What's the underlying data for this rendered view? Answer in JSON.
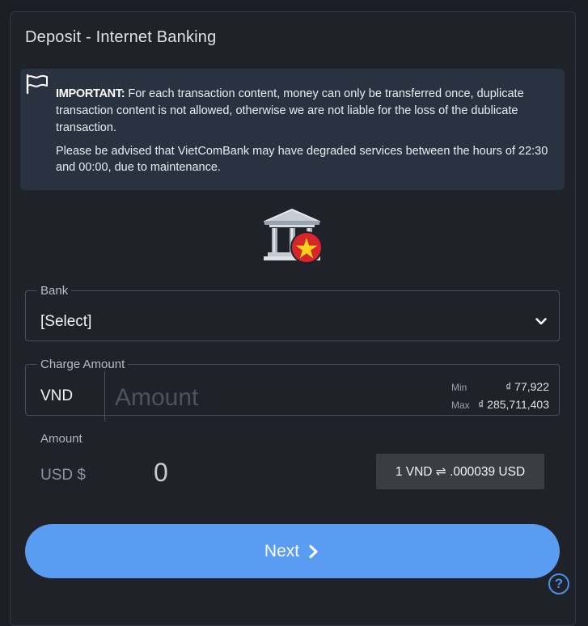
{
  "page": {
    "title": "Deposit - Internet Banking"
  },
  "notice": {
    "icon": "flag-icon",
    "important_label": "IMPORTANT:",
    "paragraph1": " For each transaction content, money can only be transferred once, duplicate transaction content is not allowed, otherwise we are not liable for the loss of the dublicate transaction.",
    "paragraph2": "Please be advised that VietComBank may have degraded services between the hours of 22:30 and 00:00, due to maintenance."
  },
  "bank_graphic": {
    "icon": "bank-vietnam-icon",
    "colors": {
      "badge": "#d7262b",
      "star": "#f7d21b"
    }
  },
  "bank_field": {
    "legend": "Bank",
    "value": "[Select]"
  },
  "charge_field": {
    "legend": "Charge Amount",
    "currency": "VND",
    "placeholder": "Amount",
    "min_label": "Min",
    "min_value": "₫ 77,922",
    "max_label": "Max",
    "max_value": "₫ 285,711,403"
  },
  "conversion": {
    "label": "Amount",
    "currency_label": "USD $",
    "value": "0",
    "rate": "1 VND ⇌ .000039 USD"
  },
  "actions": {
    "next_label": "Next",
    "help_label": "?"
  },
  "colors": {
    "background": "#1f2229",
    "notice_bg": "#2a3242",
    "accent": "#5b9cf3"
  }
}
